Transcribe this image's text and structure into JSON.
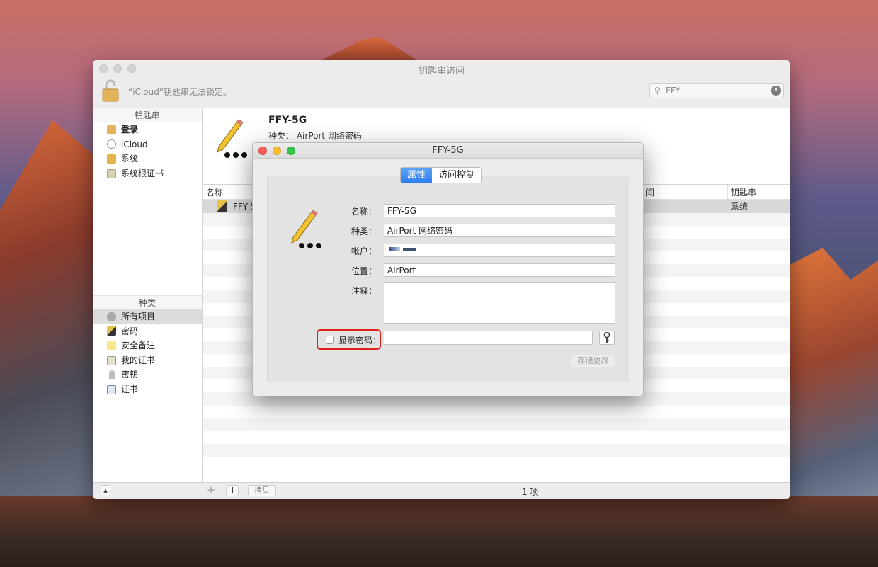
{
  "window": {
    "title": "钥匙串访问",
    "lock_note": "“iCloud”钥匙串无法锁定。",
    "search": {
      "value": "FFY"
    }
  },
  "sidebar": {
    "keychains_header": "钥匙串",
    "keychains": [
      {
        "label": "登录",
        "icon": "lock-open-icon"
      },
      {
        "label": "iCloud",
        "icon": "cloud-icon"
      },
      {
        "label": "系统",
        "icon": "lock-icon"
      },
      {
        "label": "系统根证书",
        "icon": "certificate-cabinet-icon"
      }
    ],
    "category_header": "种类",
    "categories": [
      {
        "label": "所有项目",
        "icon": "all-items-icon"
      },
      {
        "label": "密码",
        "icon": "password-icon"
      },
      {
        "label": "安全备注",
        "icon": "note-icon"
      },
      {
        "label": "我的证书",
        "icon": "my-certificate-icon"
      },
      {
        "label": "密钥",
        "icon": "key-icon"
      },
      {
        "label": "证书",
        "icon": "certificate-icon"
      }
    ]
  },
  "detail": {
    "name": "FFY-5G",
    "kind_label": "种类：",
    "kind_value": "AirPort 网络密码"
  },
  "table": {
    "col_name": "名称",
    "col_date": "间",
    "col_keychain": "钥匙串",
    "row": {
      "name": "FFY-5G",
      "keychain": "系统"
    }
  },
  "statusbar": {
    "add": "+",
    "info": "i",
    "copy": "拷贝",
    "count": "1 项"
  },
  "dialog": {
    "title": "FFY-5G",
    "tab_attributes": "属性",
    "tab_access": "访问控制",
    "name_label": "名称：",
    "name_value": "FFY-5G",
    "kind_label": "种类：",
    "kind_value": "AirPort 网络密码",
    "account_label": "帐户：",
    "account_value": "",
    "where_label": "位置：",
    "where_value": "AirPort",
    "comment_label": "注释：",
    "show_password_label": "显示密码：",
    "save_button": "存储更改"
  },
  "colors": {
    "accent_blue": "#2d7cf0",
    "highlight_red": "#e0221c"
  }
}
